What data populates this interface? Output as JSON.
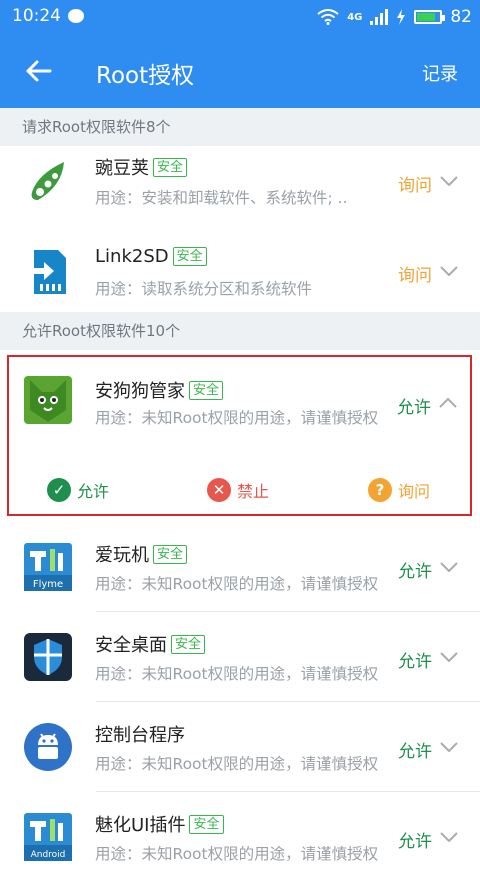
{
  "statusbar": {
    "time": "10:24",
    "network": "4G",
    "battery": "82",
    "battery_level": 0.82
  },
  "toolbar": {
    "title": "Root授权",
    "action": "记录"
  },
  "sections": {
    "requesting": "请求Root权限软件8个",
    "allowed": "允许Root权限软件10个"
  },
  "safe_badge": "安全",
  "apps": [
    {
      "name": "豌豆荚",
      "usage": "用途：安装和卸载软件、系统软件; ..",
      "status": "询问",
      "safe": true,
      "icon": "pea-pod-icon"
    },
    {
      "name": "Link2SD",
      "usage": "用途：读取系统分区和系统软件",
      "status": "询问",
      "safe": true,
      "icon": "sd-card-icon"
    },
    {
      "name": "安狗狗管家",
      "usage": "用途：未知Root权限的用途，请谨慎授权",
      "status": "允许",
      "safe": true,
      "icon": "dog-icon"
    },
    {
      "name": "爱玩机",
      "usage": "用途：未知Root权限的用途，请谨慎授权",
      "status": "允许",
      "safe": true,
      "icon": "toolbox-icon"
    },
    {
      "name": "安全桌面",
      "usage": "用途：未知Root权限的用途，请谨慎授权",
      "status": "允许",
      "safe": true,
      "icon": "shield-icon"
    },
    {
      "name": "控制台程序",
      "usage": "用途：未知Root权限的用途，请谨慎授权",
      "status": "允许",
      "safe": false,
      "icon": "android-icon"
    },
    {
      "name": "魅化UI插件",
      "usage": "用途：未知Root权限的用途，请谨慎授权",
      "status": "允许",
      "safe": true,
      "icon": "toolbox-icon"
    }
  ],
  "expanded_actions": {
    "allow": "允许",
    "deny": "禁止",
    "ask": "询问"
  },
  "icon_texts": {
    "flyme": "Flyme",
    "android": "Android"
  },
  "colors": {
    "primary": "#2f8cf0",
    "ask": "#f3a332",
    "allow": "#1f8f4d",
    "deny": "#e8574d",
    "safe": "#3bb64f",
    "highlight": "#d9262b"
  }
}
